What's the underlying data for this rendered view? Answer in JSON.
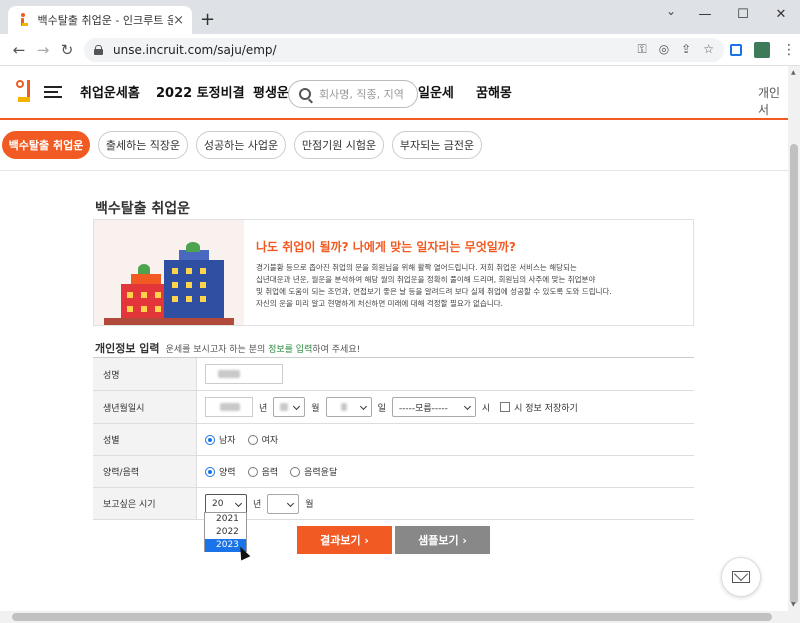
{
  "browser": {
    "tab_title": "백수탈출 취업운 - 인크루트 운세",
    "url": "unse.incruit.com/saju/emp/",
    "new_tab_label": "+",
    "tab_close": "×",
    "win_minimize": "—",
    "win_maximize": "☐",
    "win_close": "✕",
    "back": "←",
    "forward": "→",
    "reload": "↻",
    "tab_list": "⌄",
    "omni_icons": [
      "key-icon",
      "eye-off-icon",
      "share-icon",
      "star-icon"
    ],
    "more": "⋮"
  },
  "header": {
    "nav": [
      "취업운세홈",
      "2022 토정비결",
      "평생운",
      "일운세",
      "꿈해몽"
    ],
    "search_placeholder": "회사명, 직종, 지역",
    "personal": "개인서"
  },
  "categories": [
    {
      "label": "백수탈출 취업운",
      "active": true
    },
    {
      "label": "출세하는 직장운",
      "active": false
    },
    {
      "label": "성공하는 사업운",
      "active": false
    },
    {
      "label": "만점기원 시험운",
      "active": false
    },
    {
      "label": "부자되는 금전운",
      "active": false
    }
  ],
  "page_title": "백수탈출 취업운",
  "banner": {
    "headline": "나도 취업이 될까? 나에게 맞는 일자리는 무엇일까?",
    "lines": [
      "경기불황 등으로 좁아진 취업의 문을 회원님을 위해 활짝 열어드립니다. 저희 취업운 서비스는 해당되는",
      "십년대운과 년운, 월운을 분석하여 해당 월의 취업운을 정확히 풀이해 드리며, 회원님의 사주에 맞는 취업분야",
      "및 취업에 도움이 되는 조언과, 면접보기 좋은 날 등을 알려드려 보다 실제 취업에 성공할 수 있도록 도와 드립니다.",
      "자신의 운을 미리 알고 현명하게 처신하면 미래에 대해 걱정할 필요가 없습니다."
    ]
  },
  "form": {
    "section_title": "개인정보 입력",
    "section_sub_1": "운세를 보시고자 하는 분의 ",
    "section_sub_hl": "정보를 입력",
    "section_sub_2": "하여 주세요!",
    "name_label": "성명",
    "birth_label": "생년월일시",
    "unit_year": "년",
    "unit_month": "월",
    "unit_day": "일",
    "unit_hour": "시",
    "hour_value": "-----모름-----",
    "save_label": "시 정보 저장하기",
    "gender_label": "성별",
    "gender_options": [
      "남자",
      "여자"
    ],
    "gender_selected": "남자",
    "calendar_label": "양력/음력",
    "calendar_options": [
      "양력",
      "음력",
      "음력윤달"
    ],
    "calendar_selected": "양력",
    "period_label": "보고싶은 시기",
    "period_year_value": "20",
    "period_year_options": [
      "2021",
      "2022",
      "2023"
    ],
    "period_year_highlighted": "2023",
    "unit_year2": "년",
    "unit_month2": "월"
  },
  "buttons": {
    "result": "결과보기 ›",
    "sample": "샘플보기 ›"
  },
  "colors": {
    "brand": "#f15a22",
    "select_highlight": "#1a73e8"
  }
}
